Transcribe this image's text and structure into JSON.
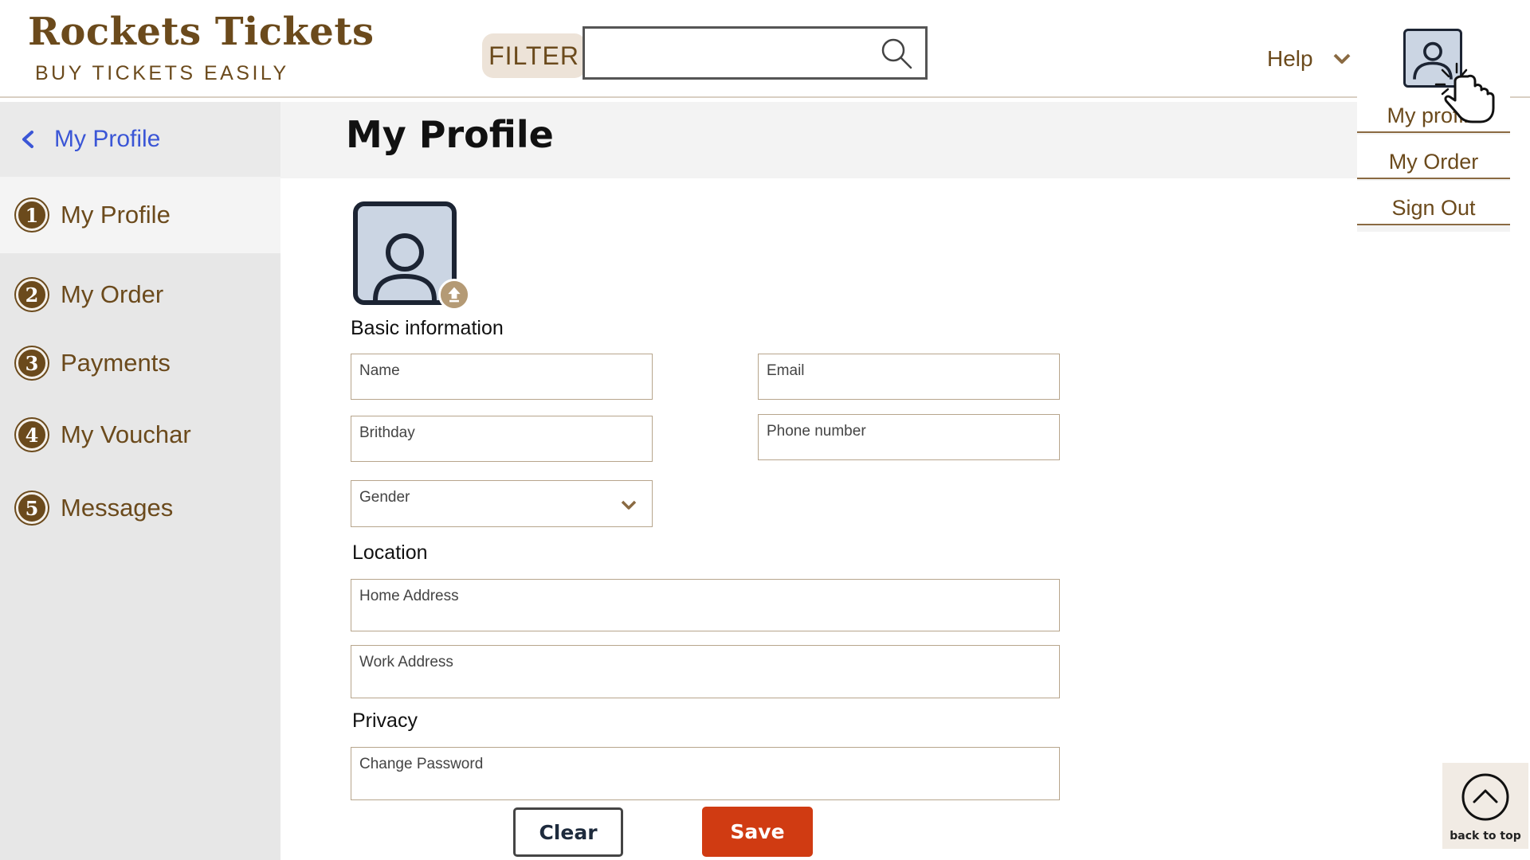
{
  "brand": {
    "title": "Rockets Tickets",
    "subtitle": "BUY TICKETS EASILY"
  },
  "header": {
    "filter_label": "FILTER",
    "search_value": "",
    "search_icon": "search-icon",
    "help_label": "Help",
    "help_icon": "chevron-down-icon",
    "avatar_icon": "user-icon"
  },
  "user_menu": {
    "items": [
      "My profile",
      "My  Order",
      "Sign Out"
    ]
  },
  "sidebar": {
    "header_label": "My Profile",
    "back_icon": "chevron-left-icon",
    "items": [
      {
        "num": "1",
        "label": "My Profile",
        "active": true
      },
      {
        "num": "2",
        "label": "My Order",
        "active": false
      },
      {
        "num": "3",
        "label": "Payments",
        "active": false
      },
      {
        "num": "4",
        "label": "My Vouchar",
        "active": false
      },
      {
        "num": "5",
        "label": "Messages",
        "active": false
      }
    ]
  },
  "main": {
    "title": "My Profile",
    "upload_icon": "upload-icon",
    "sections": {
      "basic": "Basic information",
      "location": "Location",
      "privacy": "Privacy"
    },
    "fields": {
      "name": {
        "label": "Name",
        "value": ""
      },
      "email": {
        "label": "Email",
        "value": ""
      },
      "birthday": {
        "label": "Brithday",
        "value": ""
      },
      "phone": {
        "label": "Phone number",
        "value": ""
      },
      "gender": {
        "label": "Gender",
        "value": ""
      },
      "home_address": {
        "label": "Home Address",
        "value": ""
      },
      "work_address": {
        "label": "Work Address",
        "value": ""
      },
      "password": {
        "label": "Change Password",
        "value": ""
      }
    },
    "buttons": {
      "clear": "Clear",
      "save": "Save"
    }
  },
  "back_to_top": {
    "label": "back to top",
    "icon": "chevron-up-circle-icon"
  },
  "colors": {
    "brand": "#6b4a1c",
    "accent": "#d03b12",
    "link": "#3b56d6",
    "sidebar_bg": "#e7e7e7"
  }
}
